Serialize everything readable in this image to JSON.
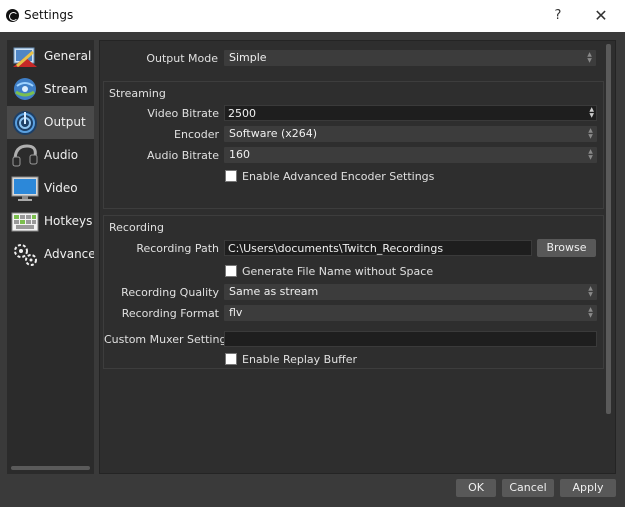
{
  "window": {
    "title": "Settings",
    "help": "?",
    "close": "✕"
  },
  "sidebar": {
    "items": [
      {
        "label": "General",
        "icon": "general-icon"
      },
      {
        "label": "Stream",
        "icon": "stream-icon"
      },
      {
        "label": "Output",
        "icon": "output-icon"
      },
      {
        "label": "Audio",
        "icon": "audio-icon"
      },
      {
        "label": "Video",
        "icon": "video-icon"
      },
      {
        "label": "Hotkeys",
        "icon": "hotkeys-icon"
      },
      {
        "label": "Advanced",
        "icon": "advanced-icon"
      }
    ],
    "active": "Output"
  },
  "output_mode": {
    "label": "Output Mode",
    "value": "Simple"
  },
  "streaming": {
    "title": "Streaming",
    "video_bitrate_label": "Video Bitrate",
    "video_bitrate": "2500",
    "encoder_label": "Encoder",
    "encoder": "Software (x264)",
    "audio_bitrate_label": "Audio Bitrate",
    "audio_bitrate": "160",
    "advanced_encoder_label": "Enable Advanced Encoder Settings",
    "advanced_encoder_checked": false
  },
  "recording": {
    "title": "Recording",
    "path_label": "Recording Path",
    "path": "C:\\Users\\documents\\Twitch_Recordings",
    "browse_label": "Browse",
    "filename_nospace_label": "Generate File Name without Space",
    "filename_nospace_checked": false,
    "quality_label": "Recording Quality",
    "quality": "Same as stream",
    "format_label": "Recording Format",
    "format": "flv",
    "muxer_label": "Custom Muxer Settings",
    "muxer": "",
    "replay_buffer_label": "Enable Replay Buffer",
    "replay_buffer_checked": false
  },
  "footer": {
    "ok": "OK",
    "cancel": "Cancel",
    "apply": "Apply"
  },
  "colors": {
    "dialog_bg": "#3a3a3a",
    "panel_bg": "#2e2e2e",
    "active_nav": "#4a4a4a"
  }
}
